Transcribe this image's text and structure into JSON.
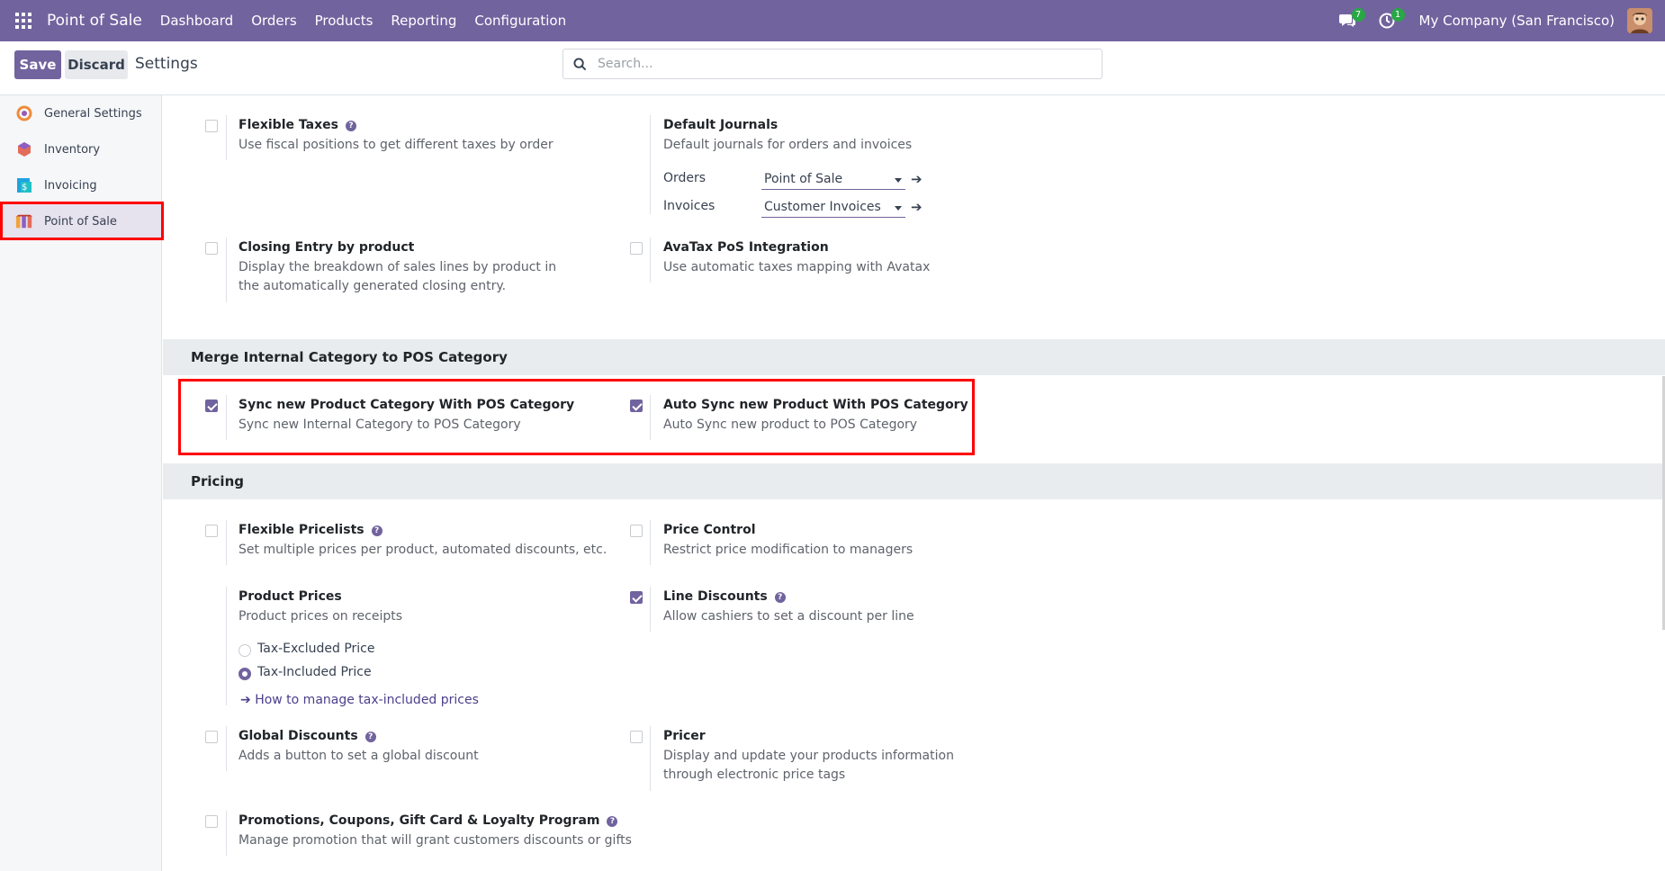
{
  "navbar": {
    "brand": "Point of Sale",
    "menu": [
      "Dashboard",
      "Orders",
      "Products",
      "Reporting",
      "Configuration"
    ],
    "messages_count": "7",
    "activities_count": "1",
    "company": "My Company (San Francisco)"
  },
  "control": {
    "save_label": "Save",
    "discard_label": "Discard",
    "title": "Settings",
    "search_placeholder": "Search..."
  },
  "sidebar": {
    "items": [
      {
        "label": "General Settings",
        "icon": "general-settings-icon"
      },
      {
        "label": "Inventory",
        "icon": "inventory-icon"
      },
      {
        "label": "Invoicing",
        "icon": "invoicing-icon"
      },
      {
        "label": "Point of Sale",
        "icon": "point-of-sale-icon",
        "active": true
      }
    ]
  },
  "taxes_section": {
    "flexible_taxes": {
      "title": "Flexible Taxes",
      "desc": "Use fiscal positions to get different taxes by order",
      "checked": false
    },
    "default_journals": {
      "title": "Default Journals",
      "desc": "Default journals for orders and invoices",
      "orders_label": "Orders",
      "orders_value": "Point of Sale",
      "invoices_label": "Invoices",
      "invoices_value": "Customer Invoices"
    },
    "closing_entry": {
      "title": "Closing Entry by product",
      "desc": "Display the breakdown of sales lines by product in the automatically generated closing entry.",
      "checked": false
    },
    "avatax": {
      "title": "AvaTax PoS Integration",
      "desc": "Use automatic taxes mapping with Avatax",
      "checked": false
    }
  },
  "merge_section": {
    "header": "Merge Internal Category to POS Category",
    "sync_category": {
      "title": "Sync new Product Category With POS Category",
      "desc": "Sync new Internal Category to POS Category",
      "checked": true
    },
    "auto_sync": {
      "title": "Auto Sync new Product With POS Category",
      "desc": "Auto Sync new product to POS Category",
      "checked": true
    }
  },
  "pricing_section": {
    "header": "Pricing",
    "flexible_pricelists": {
      "title": "Flexible Pricelists",
      "desc": "Set multiple prices per product, automated discounts, etc.",
      "checked": false
    },
    "price_control": {
      "title": "Price Control",
      "desc": "Restrict price modification to managers",
      "checked": false
    },
    "product_prices": {
      "title": "Product Prices",
      "desc": "Product prices on receipts",
      "option_excluded": "Tax-Excluded Price",
      "option_included": "Tax-Included Price",
      "selected": "Tax-Included Price",
      "link": "How to manage tax-included prices"
    },
    "line_discounts": {
      "title": "Line Discounts",
      "desc": "Allow cashiers to set a discount per line",
      "checked": true
    },
    "global_discounts": {
      "title": "Global Discounts",
      "desc": "Adds a button to set a global discount",
      "checked": false
    },
    "pricer": {
      "title": "Pricer",
      "desc": "Display and update your products information through electronic price tags",
      "checked": false
    },
    "promotions": {
      "title": "Promotions, Coupons, Gift Card & Loyalty Program",
      "desc": "Manage promotion that will grant customers discounts or gifts",
      "checked": false
    }
  },
  "colors": {
    "brand": "#71639e",
    "highlight": "#ff0000"
  }
}
